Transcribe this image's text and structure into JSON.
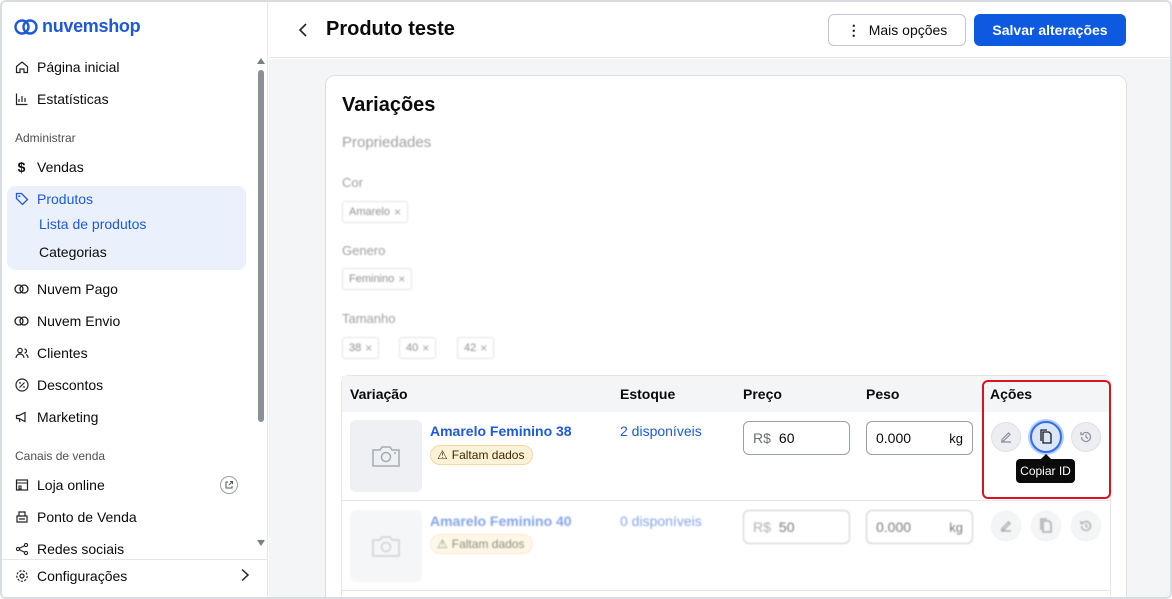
{
  "app": {
    "logo_text": "nuvemshop",
    "brand_color": "#1e59d6"
  },
  "sidebar": {
    "top_items": [
      {
        "label": "Página inicial",
        "icon": "home-icon"
      },
      {
        "label": "Estatísticas",
        "icon": "bar-chart-icon"
      }
    ],
    "section_admin": "Administrar",
    "admin_items": [
      {
        "label": "Vendas",
        "icon": "dollar-icon"
      },
      {
        "label": "Produtos",
        "icon": "tag-icon"
      }
    ],
    "produtos_sub": [
      {
        "label": "Lista de produtos"
      },
      {
        "label": "Categorias"
      }
    ],
    "more_items": [
      {
        "label": "Nuvem Pago",
        "icon": "cloud-icon"
      },
      {
        "label": "Nuvem Envio",
        "icon": "cloud-icon"
      },
      {
        "label": "Clientes",
        "icon": "users-icon"
      },
      {
        "label": "Descontos",
        "icon": "percent-icon"
      },
      {
        "label": "Marketing",
        "icon": "megaphone-icon"
      }
    ],
    "section_channels": "Canais de venda",
    "channel_items": [
      {
        "label": "Loja online",
        "icon": "store-icon"
      },
      {
        "label": "Ponto de Venda",
        "icon": "pos-icon"
      },
      {
        "label": "Redes sociais",
        "icon": "share-icon"
      }
    ],
    "config_label": "Configurações"
  },
  "header": {
    "title": "Produto teste",
    "more_label": "Mais opções",
    "save_label": "Salvar alterações"
  },
  "variations": {
    "title": "Variações",
    "properties_heading": "Propriedades",
    "properties": [
      {
        "name": "Cor",
        "values": [
          "Amarelo"
        ]
      },
      {
        "name": "Genero",
        "values": [
          "Feminino"
        ]
      },
      {
        "name": "Tamanho",
        "values": [
          "38",
          "40",
          "42"
        ]
      }
    ],
    "table": {
      "columns": [
        "Variação",
        "Estoque",
        "Preço",
        "Peso",
        "Ações"
      ],
      "rows": [
        {
          "name": "Amarelo Feminino 38",
          "warning": "Faltam dados",
          "stock": "2 disponíveis",
          "price_prefix": "R$",
          "price": "60",
          "weight": "0.000",
          "weight_unit": "kg"
        },
        {
          "name": "Amarelo Feminino 40",
          "warning": "Faltam dados",
          "stock": "0 disponíveis",
          "price_prefix": "R$",
          "price": "50",
          "weight": "0.000",
          "weight_unit": "kg"
        }
      ],
      "tooltip": "Copiar ID"
    }
  },
  "colors": {
    "primary": "#0d5ae0",
    "highlight": "#d9141d",
    "warning_bg": "#fdf1d8"
  }
}
